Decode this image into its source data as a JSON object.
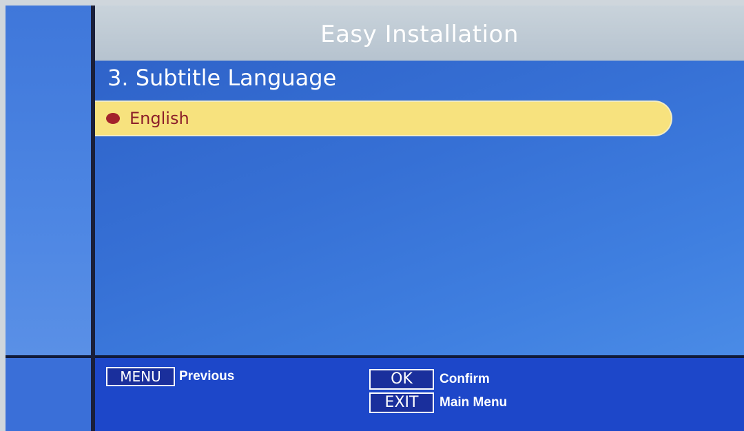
{
  "header": {
    "title": "Easy Installation"
  },
  "step": {
    "heading": "3. Subtitle Language"
  },
  "options": [
    {
      "label": "English",
      "selected": true
    }
  ],
  "footer": {
    "menu_key": "MENU",
    "menu_action": "Previous",
    "ok_key": "OK",
    "ok_action": "Confirm",
    "exit_key": "EXIT",
    "exit_action": "Main Menu"
  },
  "colors": {
    "background_blue": "#2d62d0",
    "title_bar": "#c9d3db",
    "highlight": "#f7e27e",
    "selected_text": "#8c1f2a",
    "bullet": "#a3222b"
  },
  "icons": {
    "selection_bullet": "filled-circle"
  }
}
